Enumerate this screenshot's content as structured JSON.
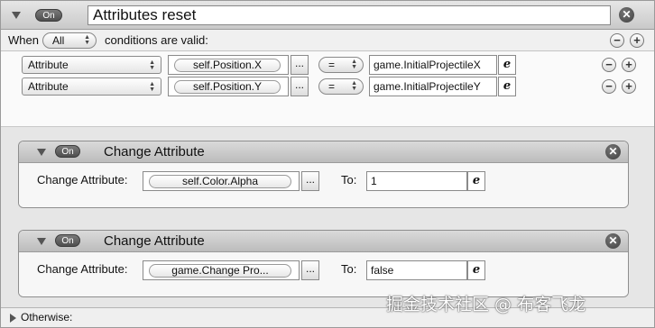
{
  "rule": {
    "on_label": "On",
    "title": "Attributes reset",
    "close_glyph": "✕"
  },
  "when": {
    "prefix": "When",
    "selector_value": "All",
    "suffix": "conditions are valid:",
    "minus": "−",
    "plus": "+"
  },
  "conditions": [
    {
      "type_value": "Attribute",
      "attribute": "self.Position.X",
      "dots": "...",
      "operator": "=",
      "expression": "game.InitialProjectileX",
      "e_label": "e",
      "minus": "−",
      "plus": "+"
    },
    {
      "type_value": "Attribute",
      "attribute": "self.Position.Y",
      "dots": "...",
      "operator": "=",
      "expression": "game.InitialProjectileY",
      "e_label": "e",
      "minus": "−",
      "plus": "+"
    }
  ],
  "actions": [
    {
      "on_label": "On",
      "title": "Change Attribute",
      "close_glyph": "✕",
      "field_label": "Change Attribute:",
      "attribute": "self.Color.Alpha",
      "dots": "...",
      "to_label": "To:",
      "to_value": "1",
      "e_label": "e"
    },
    {
      "on_label": "On",
      "title": "Change Attribute",
      "close_glyph": "✕",
      "field_label": "Change Attribute:",
      "attribute": "game.Change Pro...",
      "dots": "...",
      "to_label": "To:",
      "to_value": "false",
      "e_label": "e"
    }
  ],
  "footer": {
    "otherwise_label": "Otherwise:"
  },
  "watermark": "掘金技术社区 @ 布客飞龙",
  "colors": {
    "header_bg": "#d2d2d2",
    "action_region_bg": "#e6e6e6",
    "pill_dark": "#5a5a5a"
  }
}
